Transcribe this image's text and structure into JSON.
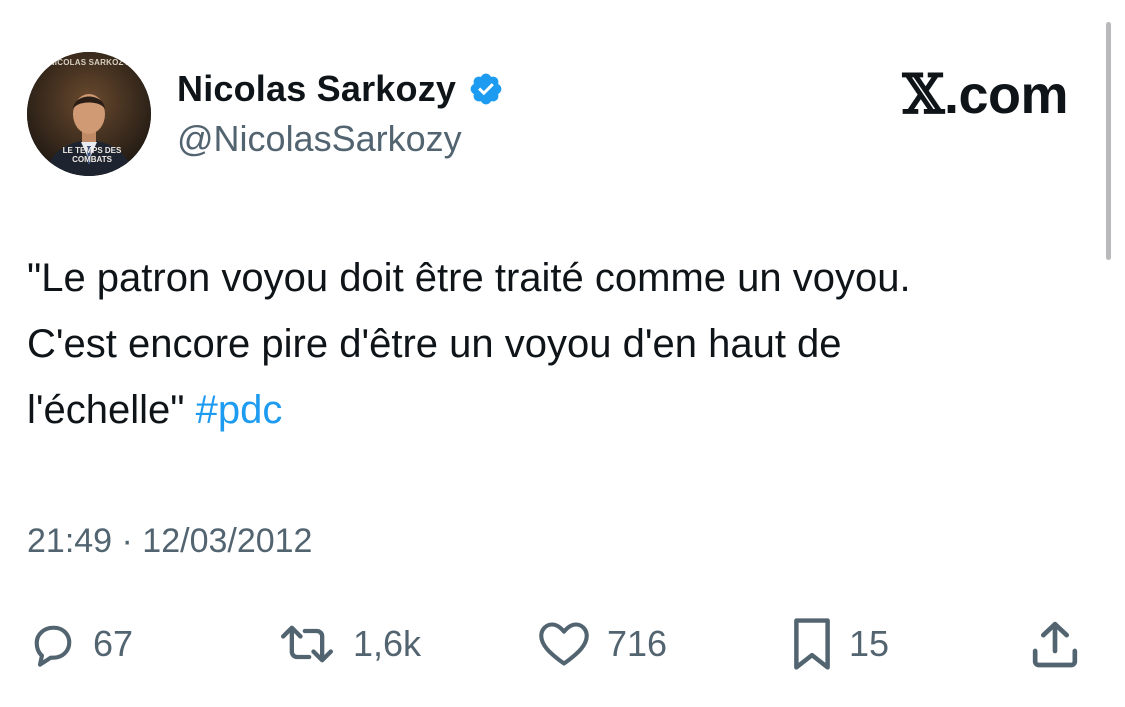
{
  "author": {
    "display_name": "Nicolas Sarkozy",
    "handle": "@NicolasSarkozy",
    "verified": true,
    "avatar_caption": "NICOLAS SARKOZY",
    "avatar_book_title": "LE TEMPS DES COMBATS"
  },
  "brand": {
    "label": ".com",
    "x_mark": "𝕏"
  },
  "tweet": {
    "lines": [
      "\"Le patron voyou doit être traité comme un voyou.",
      "C'est encore pire d'être un voyou d'en haut de",
      "l'échelle\" "
    ],
    "hashtag": "#pdc",
    "timestamp": "21:49 · 12/03/2012"
  },
  "actions": {
    "replies": "67",
    "retweets": "1,6k",
    "likes": "716",
    "bookmarks": "15"
  },
  "colors": {
    "text": "#0f1419",
    "secondary": "#536471",
    "accent": "#1d9bf0"
  },
  "icons": {
    "verified": "verified-badge-icon",
    "reply": "reply-bubble-icon",
    "retweet": "retweet-icon",
    "like": "heart-icon",
    "bookmark": "bookmark-icon",
    "share": "share-upload-icon"
  }
}
